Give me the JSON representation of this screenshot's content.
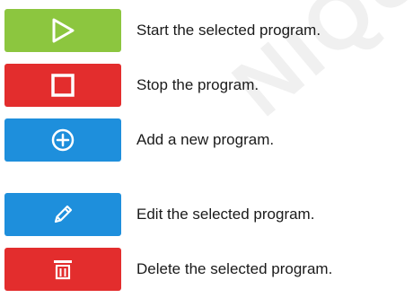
{
  "colors": {
    "green": "#8cc63f",
    "red": "#e32d2d",
    "blue": "#1e8fdc",
    "text": "#1a1a1a"
  },
  "buttons": [
    {
      "icon": "play-icon",
      "color": "#8cc63f",
      "description": "Start the selected program."
    },
    {
      "icon": "stop-icon",
      "color": "#e32d2d",
      "description": "Stop the program."
    },
    {
      "icon": "add-circle-icon",
      "color": "#1e8fdc",
      "description": "Add a new program."
    },
    {
      "icon": "pencil-icon",
      "color": "#1e8fdc",
      "description": "Edit the selected program."
    },
    {
      "icon": "trash-icon",
      "color": "#e32d2d",
      "description": "Delete the selected program."
    }
  ],
  "watermark": "NIQUE"
}
